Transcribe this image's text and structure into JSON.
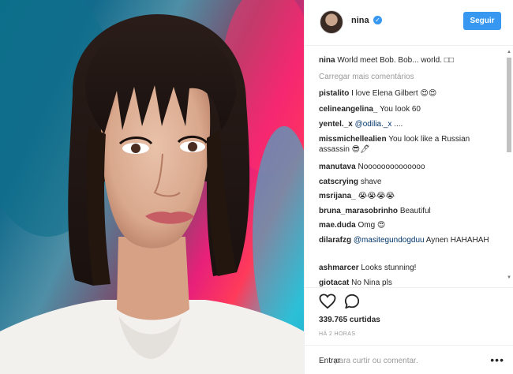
{
  "header": {
    "username": "nina",
    "verified": true,
    "follow_label": "Seguir"
  },
  "caption": {
    "user": "nina",
    "text": "World meet Bob. Bob... world. □□"
  },
  "load_more": "Carregar mais comentários",
  "comments": [
    {
      "user": "pistalito",
      "text": "I love Elena Gilbert 😍😍"
    },
    {
      "user": "celineangelina_",
      "text": "You look 60"
    },
    {
      "user": "yentel._x",
      "mention": "@odilia._x",
      "text": " ...."
    },
    {
      "user": "missmichellealien",
      "text": "You look like a Russian assassin 😎🖊"
    },
    {
      "user": "manutava",
      "text": "Noooooooooooooo"
    },
    {
      "user": "catscrying",
      "text": "shave"
    },
    {
      "user": "msrijana_",
      "text": "😭😭😭😭"
    },
    {
      "user": "bruna_marasobrinho",
      "text": "Beautiful"
    },
    {
      "user": "mae.duda",
      "text": "Omg 😍"
    },
    {
      "user": "dilarafzg",
      "mention": "@masitegundogduu",
      "text": " Aynen HAHAHAH"
    },
    {
      "user": "ashmarcer",
      "text": "Looks stunning!"
    },
    {
      "user": "giotacat",
      "text": "No Nina pls"
    }
  ],
  "likes": "339.765 curtidas",
  "time": "HÁ 2 HORAS",
  "comment_input": {
    "enter": "Entrar",
    "placeholder": "para curtir ou comentar."
  },
  "colors": {
    "accent": "#3897f0",
    "mention": "#003569",
    "muted": "#999999"
  }
}
